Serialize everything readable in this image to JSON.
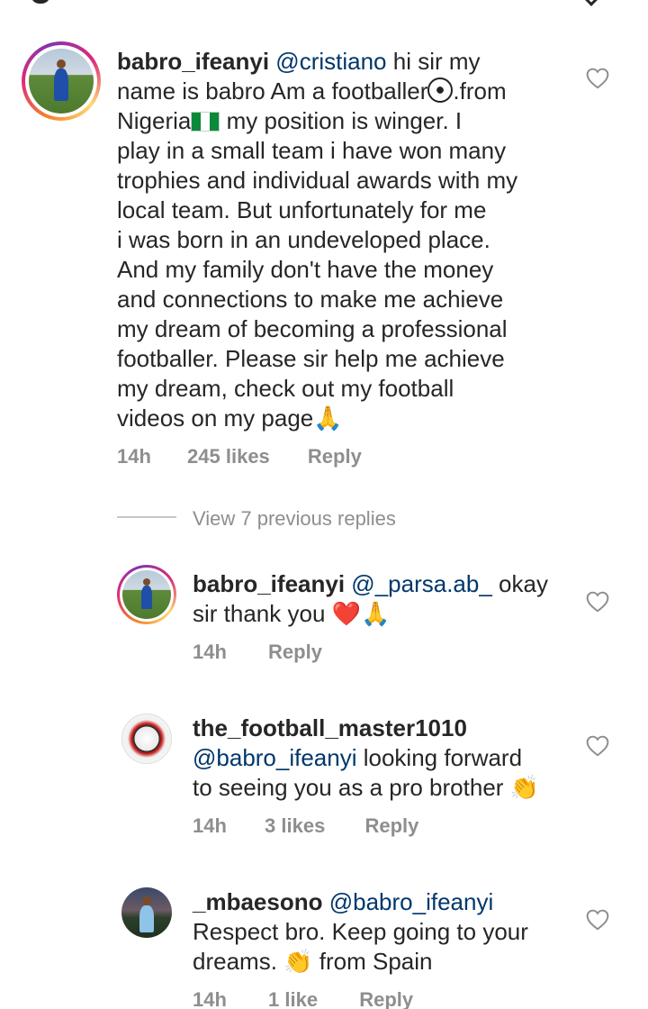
{
  "comments": [
    {
      "username": "babro_ifeanyi",
      "mention": "@cristiano",
      "text_lines": [
        " hi sir my",
        "name is babro Am a footballer",
        ".from",
        "Nigeria",
        " my position is winger. I",
        "play in a small team i have won many",
        "trophies and individual awards with my",
        "local team. But unfortunately for me",
        "i was born in an undeveloped place.",
        "And my family don't have the money",
        "and connections to make me achieve",
        "my dream of becoming a professional",
        "footballer. Please sir help me achieve",
        "my dream, check out my football",
        "videos on my page"
      ],
      "time": "14h",
      "likes": "245 likes",
      "reply": "Reply"
    }
  ],
  "view_replies": "View 7 previous replies",
  "replies": [
    {
      "username": "babro_ifeanyi",
      "mention": "@_parsa.ab_",
      "line1_rest": " okay",
      "line2": "sir thank you ",
      "time": "14h",
      "reply": "Reply"
    },
    {
      "username": "the_football_master1010",
      "mention": "@babro_ifeanyi",
      "line2_rest": " looking forward",
      "line3": "to seeing you as a pro brother ",
      "time": "14h",
      "likes": "3 likes",
      "reply": "Reply"
    },
    {
      "username": "_mbaesono",
      "mention": "@babro_ifeanyi",
      "line2": "Respect bro. Keep going to your",
      "line3a": "dreams. ",
      "line3b": " from Spain",
      "time": "14h",
      "likes": "1 like",
      "reply": "Reply"
    }
  ],
  "colors": {
    "text": "#262626",
    "mention": "#00376b",
    "meta": "#8e8e8e"
  },
  "icons": [
    "heart-outline-icon",
    "soccer-ball-emoji",
    "nigeria-flag-emoji",
    "praying-hands-emoji",
    "red-heart-emoji",
    "clapping-hands-emoji"
  ]
}
